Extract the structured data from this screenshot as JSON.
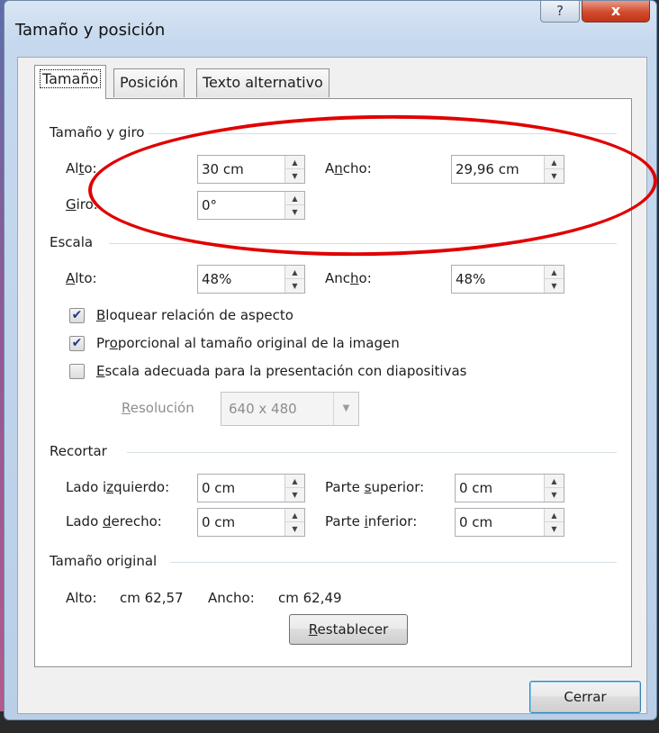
{
  "window": {
    "title": "Tamaño y posición",
    "help_label": "?",
    "close_label": "x"
  },
  "tabs": [
    {
      "label": "Tamaño"
    },
    {
      "label": "Posición"
    },
    {
      "label": "Texto alternativo"
    }
  ],
  "size": {
    "heading": "Tamaño y giro",
    "height": {
      "label_pre": "Al",
      "label_u": "t",
      "label_post": "o:",
      "value": "30 cm"
    },
    "width": {
      "label_pre": "A",
      "label_u": "n",
      "label_post": "cho:",
      "value": "29,96 cm"
    },
    "rotation": {
      "label_pre": "",
      "label_u": "G",
      "label_post": "iro:",
      "value": "0°"
    }
  },
  "scale": {
    "heading": "Escala",
    "height": {
      "label_pre": "",
      "label_u": "A",
      "label_post": "lto:",
      "value": "48%"
    },
    "width": {
      "label_pre": "Anc",
      "label_u": "h",
      "label_post": "o:",
      "value": "48%"
    },
    "lock_aspect": {
      "label_u": "B",
      "label_post": "loquear relación de aspecto",
      "checked": true
    },
    "relative_original": {
      "label_pre": "Pr",
      "label_u": "o",
      "label_post": "porcional al tamaño original de la imagen",
      "checked": true
    },
    "best_scale": {
      "label_u": "E",
      "label_post": "scala adecuada para la presentación con diapositivas",
      "checked": false
    },
    "resolution": {
      "label_u": "R",
      "label_post": "esolución",
      "value": "640 x 480"
    }
  },
  "crop": {
    "heading": "Recortar",
    "left": {
      "label_pre": "Lado i",
      "label_u": "z",
      "label_post": "quierdo:",
      "value": "0 cm"
    },
    "right": {
      "label_pre": "Lado ",
      "label_u": "d",
      "label_post": "erecho:",
      "value": "0 cm"
    },
    "top": {
      "label_pre": "Parte ",
      "label_u": "s",
      "label_post": "uperior:",
      "value": "0 cm"
    },
    "bottom": {
      "label_pre": "Parte ",
      "label_u": "i",
      "label_post": "nferior:",
      "value": "0 cm"
    }
  },
  "original": {
    "heading": "Tamaño original",
    "height_label": "Alto:",
    "height_value": "cm 62,57",
    "width_label": "Ancho:",
    "width_value": "cm 62,49",
    "reset_u": "R",
    "reset_post": "establecer"
  },
  "footer": {
    "close_label": "Cerrar"
  },
  "colors": {
    "annotation": "#e00000",
    "checkmark": "#1f3c8a"
  }
}
